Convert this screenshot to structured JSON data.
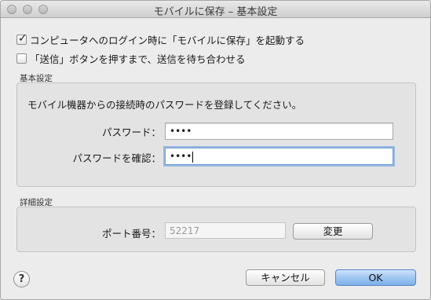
{
  "window": {
    "title": "モバイルに保存 – 基本設定"
  },
  "options": {
    "launch_on_login": {
      "label": "コンピュータへのログイン時に「モバイルに保存」を起動する",
      "checked": true
    },
    "wait_send": {
      "label": "「送信」ボタンを押すまで、送信を待ち合わせる",
      "checked": false
    }
  },
  "basic": {
    "section_title": "基本設定",
    "description": "モバイル機器からの接続時のパスワードを登録してください。",
    "password_label": "パスワード：",
    "password_value": "••••",
    "confirm_label": "パスワードを確認：",
    "confirm_value": "••••"
  },
  "advanced": {
    "section_title": "詳細設定",
    "port_label": "ポート番号：",
    "port_value": "52217",
    "change_label": "変更"
  },
  "footer": {
    "help_label": "?",
    "cancel_label": "キャンセル",
    "ok_label": "OK"
  }
}
